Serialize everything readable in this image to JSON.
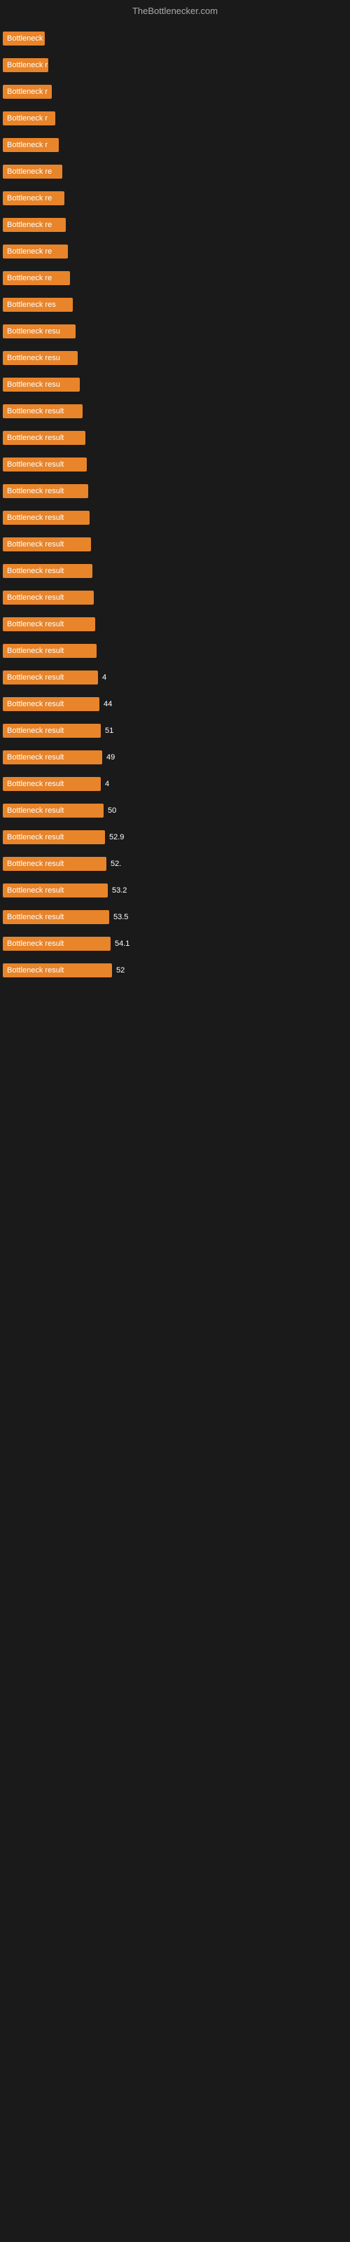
{
  "header": {
    "title": "TheBottlenecker.com"
  },
  "rows": [
    {
      "label": "Bottleneck",
      "width": 60,
      "value": ""
    },
    {
      "label": "Bottleneck r",
      "width": 65,
      "value": ""
    },
    {
      "label": "Bottleneck r",
      "width": 70,
      "value": ""
    },
    {
      "label": "Bottleneck r",
      "width": 75,
      "value": ""
    },
    {
      "label": "Bottleneck r",
      "width": 80,
      "value": ""
    },
    {
      "label": "Bottleneck re",
      "width": 85,
      "value": ""
    },
    {
      "label": "Bottleneck re",
      "width": 88,
      "value": ""
    },
    {
      "label": "Bottleneck re",
      "width": 90,
      "value": ""
    },
    {
      "label": "Bottleneck re",
      "width": 93,
      "value": ""
    },
    {
      "label": "Bottleneck re",
      "width": 96,
      "value": ""
    },
    {
      "label": "Bottleneck res",
      "width": 100,
      "value": ""
    },
    {
      "label": "Bottleneck resu",
      "width": 104,
      "value": ""
    },
    {
      "label": "Bottleneck resu",
      "width": 107,
      "value": ""
    },
    {
      "label": "Bottleneck resu",
      "width": 110,
      "value": ""
    },
    {
      "label": "Bottleneck result",
      "width": 114,
      "value": ""
    },
    {
      "label": "Bottleneck result",
      "width": 118,
      "value": ""
    },
    {
      "label": "Bottleneck result",
      "width": 120,
      "value": ""
    },
    {
      "label": "Bottleneck result",
      "width": 122,
      "value": ""
    },
    {
      "label": "Bottleneck result",
      "width": 124,
      "value": ""
    },
    {
      "label": "Bottleneck result",
      "width": 126,
      "value": ""
    },
    {
      "label": "Bottleneck result",
      "width": 128,
      "value": ""
    },
    {
      "label": "Bottleneck result",
      "width": 130,
      "value": ""
    },
    {
      "label": "Bottleneck result",
      "width": 132,
      "value": ""
    },
    {
      "label": "Bottleneck result",
      "width": 134,
      "value": ""
    },
    {
      "label": "Bottleneck result",
      "width": 136,
      "value": "4"
    },
    {
      "label": "Bottleneck result",
      "width": 138,
      "value": "44"
    },
    {
      "label": "Bottleneck result",
      "width": 140,
      "value": "51"
    },
    {
      "label": "Bottleneck result",
      "width": 142,
      "value": "49"
    },
    {
      "label": "Bottleneck result",
      "width": 140,
      "value": "4"
    },
    {
      "label": "Bottleneck result",
      "width": 144,
      "value": "50"
    },
    {
      "label": "Bottleneck result",
      "width": 146,
      "value": "52.9"
    },
    {
      "label": "Bottleneck result",
      "width": 148,
      "value": "52."
    },
    {
      "label": "Bottleneck result",
      "width": 150,
      "value": "53.2"
    },
    {
      "label": "Bottleneck result",
      "width": 152,
      "value": "53.5"
    },
    {
      "label": "Bottleneck result",
      "width": 154,
      "value": "54.1"
    },
    {
      "label": "Bottleneck result",
      "width": 156,
      "value": "52"
    }
  ]
}
